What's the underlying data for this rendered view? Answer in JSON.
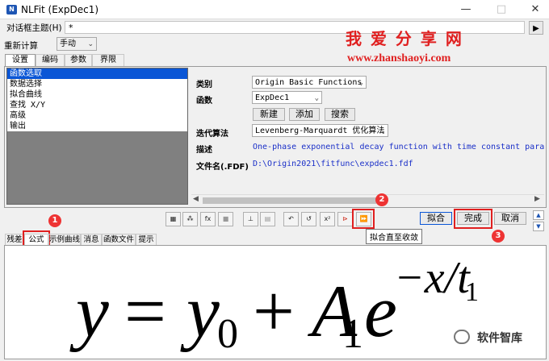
{
  "window": {
    "title": "NLFit (ExpDec1)",
    "app_icon": "nlfit-app-icon",
    "minimize": "—",
    "maximize": "□",
    "close": "✕"
  },
  "dialog_theme": {
    "label": "对话框主题(H)",
    "value": "*"
  },
  "recalc": {
    "label": "重新计算",
    "value": "手动"
  },
  "top_tabs": [
    {
      "label": "设置"
    },
    {
      "label": "编码"
    },
    {
      "label": "参数"
    },
    {
      "label": "界限"
    }
  ],
  "left_list": [
    "函数选取",
    "数据选择",
    "拟合曲线",
    "查找 X/Y",
    "高级",
    "输出"
  ],
  "props": {
    "category_label": "类别",
    "category_value": "Origin Basic Functions",
    "function_label": "函数",
    "function_value": "ExpDec1",
    "new_button": "新建",
    "add_button": "添加",
    "search_button": "搜索",
    "iter_label": "迭代算法",
    "iter_value": "Levenberg-Marquardt 优化算法",
    "desc_label": "描述",
    "desc_value": "One-phase exponential decay function with time constant paramete",
    "file_label": "文件名(.FDF)",
    "file_value": "D:\\Origin2021\\fitfunc\\expdec1.fdf"
  },
  "watermark": {
    "title": "我 爱 分 享 网",
    "url": "www.zhanshaoyi.com"
  },
  "bottom_tabs": [
    {
      "label": "残差"
    },
    {
      "label": "公式"
    },
    {
      "label": "示例曲线"
    },
    {
      "label": "消息"
    },
    {
      "label": "函数文件"
    },
    {
      "label": "提示"
    }
  ],
  "actions": {
    "fit": "拟合",
    "done": "完成",
    "cancel": "取消"
  },
  "tooltip": "拟合直至收敛",
  "markers": [
    "1",
    "2",
    "3"
  ],
  "formula": {
    "y": "y",
    "eq": "=",
    "y0_base": "y",
    "y0_sub": "0",
    "plus": "+",
    "A_base": "A",
    "A_sub": "1",
    "e": "e",
    "exp": "−x/t",
    "exp_sub": "1"
  },
  "brand": "软件智库",
  "colors": {
    "accent": "#1e56b4",
    "select": "#0a56d6",
    "red": "#e02020",
    "watermark": "#e02020"
  }
}
